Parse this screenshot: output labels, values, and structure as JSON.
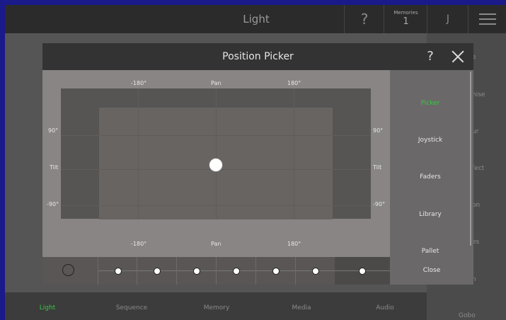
{
  "topbar": {
    "title": "Light",
    "help": "?",
    "memories_label": "Memories",
    "memories_value": "1",
    "user": "J"
  },
  "background_panel": {
    "items": [
      "e",
      "hise",
      "ur",
      "fect",
      "on",
      "es",
      "n",
      "Gobo"
    ]
  },
  "bottom_nav": {
    "items": [
      "Light",
      "Sequence",
      "Memory",
      "Media",
      "Audio"
    ],
    "active": "Light",
    "active_color": "#37c843"
  },
  "dialog": {
    "title": "Position Picker",
    "help": "?",
    "picker": {
      "top_left_pan": "-180°",
      "top_pan_label": "Pan",
      "top_right_pan": "180°",
      "bottom_left_pan": "-180°",
      "bottom_pan_label": "Pan",
      "bottom_right_pan": "180°",
      "left_tilt_top": "90°",
      "left_tilt_label": "Tilt",
      "left_tilt_bottom": "-90°",
      "right_tilt_top": "90°",
      "right_tilt_label": "Tilt",
      "right_tilt_bottom": "-90°"
    },
    "menu": {
      "items": [
        "Picker",
        "Joystick",
        "Faders",
        "Library",
        "Pallet"
      ],
      "active": "Picker",
      "active_color": "#37c843"
    },
    "close_label": "Close"
  }
}
